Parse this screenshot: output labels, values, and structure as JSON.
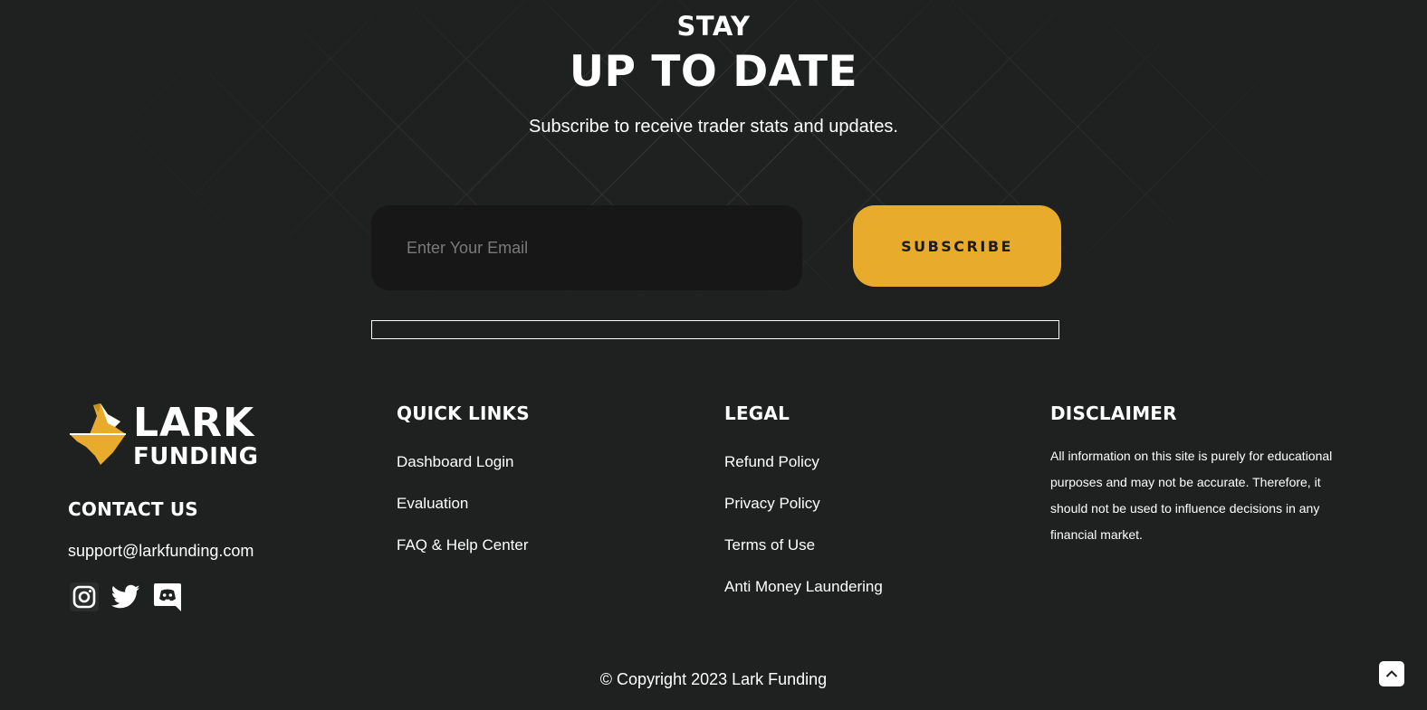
{
  "hero": {
    "stay": "STAY",
    "title": "UP TO DATE",
    "subtitle": "Subscribe to receive trader stats and updates."
  },
  "subscribe_form": {
    "email_placeholder": "Enter Your Email",
    "email_value": "",
    "button_label": "SUBSCRIBE"
  },
  "brand": {
    "line1": "LARK",
    "line2": "FUNDING",
    "accent_color": "#e9ab2c"
  },
  "contact": {
    "heading": "CONTACT US",
    "email": "support@larkfunding.com",
    "socials": [
      "instagram-icon",
      "twitter-icon",
      "discord-icon"
    ]
  },
  "quick_links": {
    "heading": "QUICK LINKS",
    "items": [
      "Dashboard Login",
      "Evaluation",
      "FAQ & Help Center"
    ]
  },
  "legal": {
    "heading": "LEGAL",
    "items": [
      "Refund Policy",
      "Privacy Policy",
      "Terms of Use",
      "Anti Money Laundering"
    ]
  },
  "disclaimer": {
    "heading": "DISCLAIMER",
    "text": "All information on this site is purely for educational purposes and may not be accurate. Therefore, it should not be used to influence decisions in any financial market."
  },
  "footer": {
    "copyright": "© Copyright 2023 Lark Funding"
  },
  "colors": {
    "background": "#1f2020",
    "input_background": "#171717",
    "button": "#e9ab2c"
  }
}
